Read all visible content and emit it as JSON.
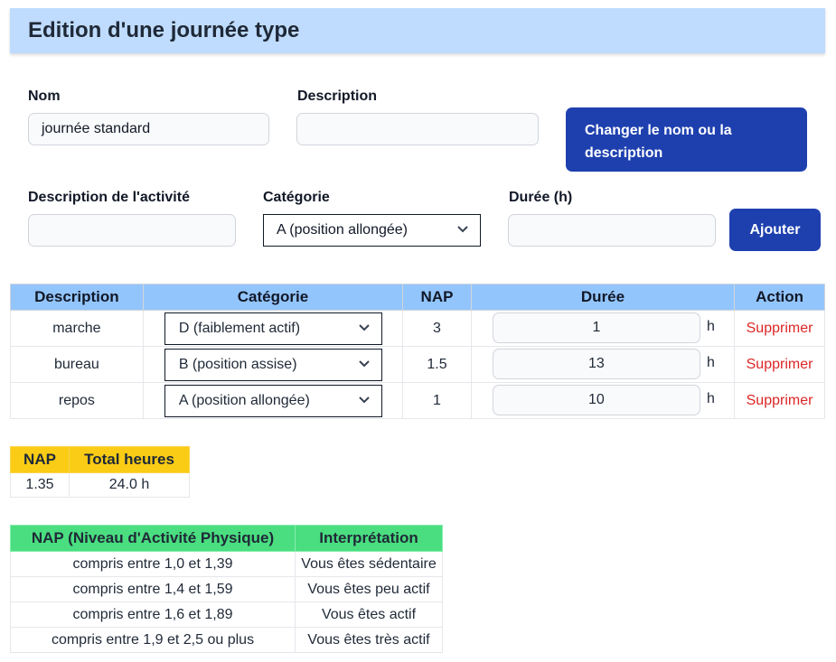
{
  "header": {
    "title": "Edition d'une journée type"
  },
  "form": {
    "nom_label": "Nom",
    "nom_value": "journée standard",
    "description_label": "Description",
    "description_value": "",
    "change_button": "Changer le nom ou la description",
    "activity_label": "Description de l'activité",
    "activity_value": "",
    "category_label": "Catégorie",
    "category_value": "A (position allongée)",
    "duration_label": "Durée (h)",
    "duration_value": "",
    "add_button": "Ajouter"
  },
  "activities": {
    "headers": [
      "Description",
      "Catégorie",
      "NAP",
      "Durée",
      "Action"
    ],
    "unit": "h",
    "delete_label": "Supprimer",
    "rows": [
      {
        "description": "marche",
        "category": "D (faiblement actif)",
        "nap": "3",
        "duration": "1"
      },
      {
        "description": "bureau",
        "category": "B (position assise)",
        "nap": "1.5",
        "duration": "13"
      },
      {
        "description": "repos",
        "category": "A (position allongée)",
        "nap": "1",
        "duration": "10"
      }
    ]
  },
  "summary": {
    "headers": [
      "NAP",
      "Total heures"
    ],
    "nap": "1.35",
    "total": "24.0 h"
  },
  "reference": {
    "headers": [
      "NAP (Niveau d'Activité Physique)",
      "Interprétation"
    ],
    "rows": [
      {
        "range": "compris entre 1,0 et 1,39",
        "meaning": "Vous êtes sédentaire"
      },
      {
        "range": "compris entre 1,4 et 1,59",
        "meaning": "Vous êtes peu actif"
      },
      {
        "range": "compris entre 1,6 et 1,89",
        "meaning": "Vous êtes actif"
      },
      {
        "range": "compris entre 1,9 et 2,5 ou plus",
        "meaning": "Vous êtes très actif"
      }
    ]
  }
}
